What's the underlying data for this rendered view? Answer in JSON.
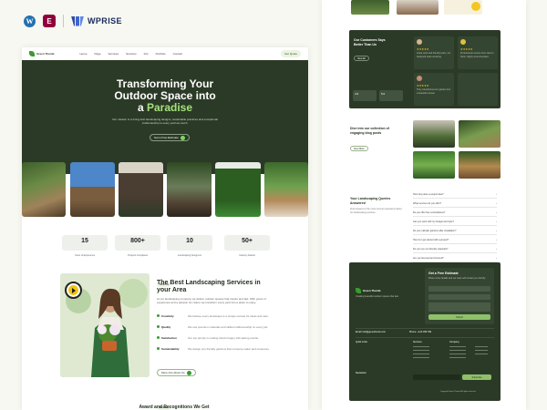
{
  "brand_bar": {
    "wordpress_letter": "W",
    "elementor_letter": "E",
    "wprise_label": "WPRISE"
  },
  "left_page": {
    "nav": {
      "brand": "Green Thumb",
      "links": [
        "Home",
        "Page",
        "Services",
        "Services",
        "Info",
        "Portfolio",
        "Contact"
      ],
      "cta": "Get Quote"
    },
    "hero": {
      "title_line1": "Transforming Your",
      "title_line2": "Outdoor Space into",
      "title_prefix": "a",
      "title_highlight": "Paradise",
      "description": "Our mission is to bring lush landscaping designs, sustainable practices and exceptional craftsmanship to every yard we touch.",
      "button": "Get a Free Estimate"
    },
    "stats": [
      {
        "value": "15",
        "label": "Years of Experience"
      },
      {
        "value": "800+",
        "label": "Projects Completed"
      },
      {
        "value": "10",
        "label": "Landscaping Designers"
      },
      {
        "value": "50+",
        "label": "Industry Awards"
      }
    ],
    "services": {
      "badge": "About Us",
      "title": "The Best Landscaping Services in your Area",
      "intro": "At our landscaping company we deliver outdoor spaces that inspire and last. With years of experience and a passion for nature we transform every yard into a place to enjoy.",
      "items": [
        {
          "name": "Creativity",
          "text": "We believe every landscape is a unique canvas for ideas and care."
        },
        {
          "name": "Quality",
          "text": "We use premium materials and skilled craftsmanship on every job."
        },
        {
          "name": "Satisfaction",
          "text": "Our top priority is making clients happy with lasting results."
        },
        {
          "name": "Sustainability",
          "text": "We design eco friendly gardens that conserve water and resources."
        }
      ],
      "button": "More Info About Us",
      "next_badge": "Portfolio",
      "next_title": "Award and Recognitions We Get"
    }
  },
  "right_page": {
    "testimonials": {
      "title": "Our Customers Says Better Than Us",
      "button": "View All",
      "cards": [
        {
          "name": "Jessica",
          "text": "Great work and friendly team, our backyard looks amazing."
        },
        {
          "name": "Michael",
          "text": "Professional service from start to finish, highly recommended."
        },
        {
          "name": "Daniel",
          "text": "They transformed our garden into a beautiful retreat."
        }
      ],
      "ratings": [
        {
          "value": "4.9"
        },
        {
          "value": "5.0"
        }
      ]
    },
    "gallery": {
      "title": "Dive into our collection of engaging blog posts",
      "button": "View More"
    },
    "faq": {
      "title": "Your Landscaping Queries Answered",
      "intro": "Find answers to the most common questions about our landscaping services.",
      "questions": [
        "How long does a project take?",
        "What services do you offer?",
        "Do you offer free consultations?",
        "Can you work with my budget and style?",
        "Do you maintain gardens after installation?",
        "How do I get started with a project?",
        "Do you use eco friendly materials?",
        "Are you licensed and insured?"
      ]
    },
    "footer": {
      "brand": "Green Thumb",
      "tagline": "Creating beautiful outdoor spaces that last.",
      "form_title": "Get a Free Estimate",
      "form_text": "Share a few details and our team will contact you shortly.",
      "submit": "Submit",
      "email": "Email: info@greenthumb.com",
      "phone": "Phone: +123 456 789",
      "columns": [
        "Quick Links",
        "Services",
        "Company"
      ],
      "newsletter": "Newsletter",
      "subscribe": "Subscribe",
      "copyright": "Copyright Green Thumb. All rights reserved."
    }
  }
}
